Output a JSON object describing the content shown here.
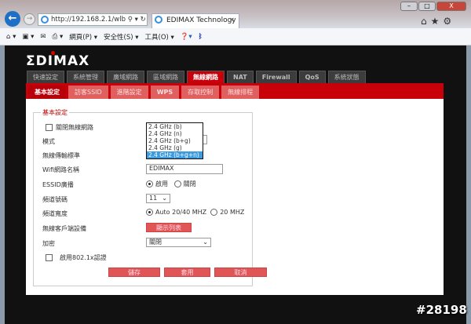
{
  "browser": {
    "address": "http://192.168.2.1/wlb",
    "tab_title": "EDIMAX Technology",
    "window_buttons": [
      "–",
      "□",
      "X"
    ],
    "command_bar": [
      "網頁(P) ▾",
      "安全性(S) ▾",
      "工具(O) ▾"
    ]
  },
  "logo": "EDIMAX",
  "main_tabs": [
    "快速設定",
    "系統管理",
    "廣域網路",
    "區域網路",
    "無線網路",
    "NAT",
    "Firewall",
    "QoS",
    "系統狀態"
  ],
  "sub_tabs": [
    "基本設定",
    "訪客SSID",
    "進階設定",
    "WPS",
    "存取控制",
    "無線排程"
  ],
  "form": {
    "legend": "基本設定",
    "disable_wireless": "關閉無線網路",
    "mode_label": "模式",
    "standard_label": "無線傳輸標準",
    "ssid_label": "Wifi網路名稱",
    "ssid_value": "EDIMAX",
    "essid_label": "ESSID廣播",
    "essid_on": "啟用",
    "essid_off": "關閉",
    "channel_label": "頻道號碼",
    "channel_value": "11",
    "width_label": "頻道寬度",
    "width_auto": "Auto 20/40 MHZ",
    "width_20": "20 MHZ",
    "clients_label": "無線客戶端設備",
    "clients_button": "顯示列表",
    "encryption_label": "加密",
    "encryption_value": "關閉",
    "enable_8021x": "啟用802.1x認證",
    "save": "儲存",
    "apply": "套用",
    "cancel": "取消"
  },
  "standard_options": [
    "2.4 GHz (b)",
    "2.4 GHz (n)",
    "2.4 GHz (b+g)",
    "2.4 GHz (g)",
    "2.4 GHz (b+g+n)"
  ],
  "watermark": "#28198"
}
